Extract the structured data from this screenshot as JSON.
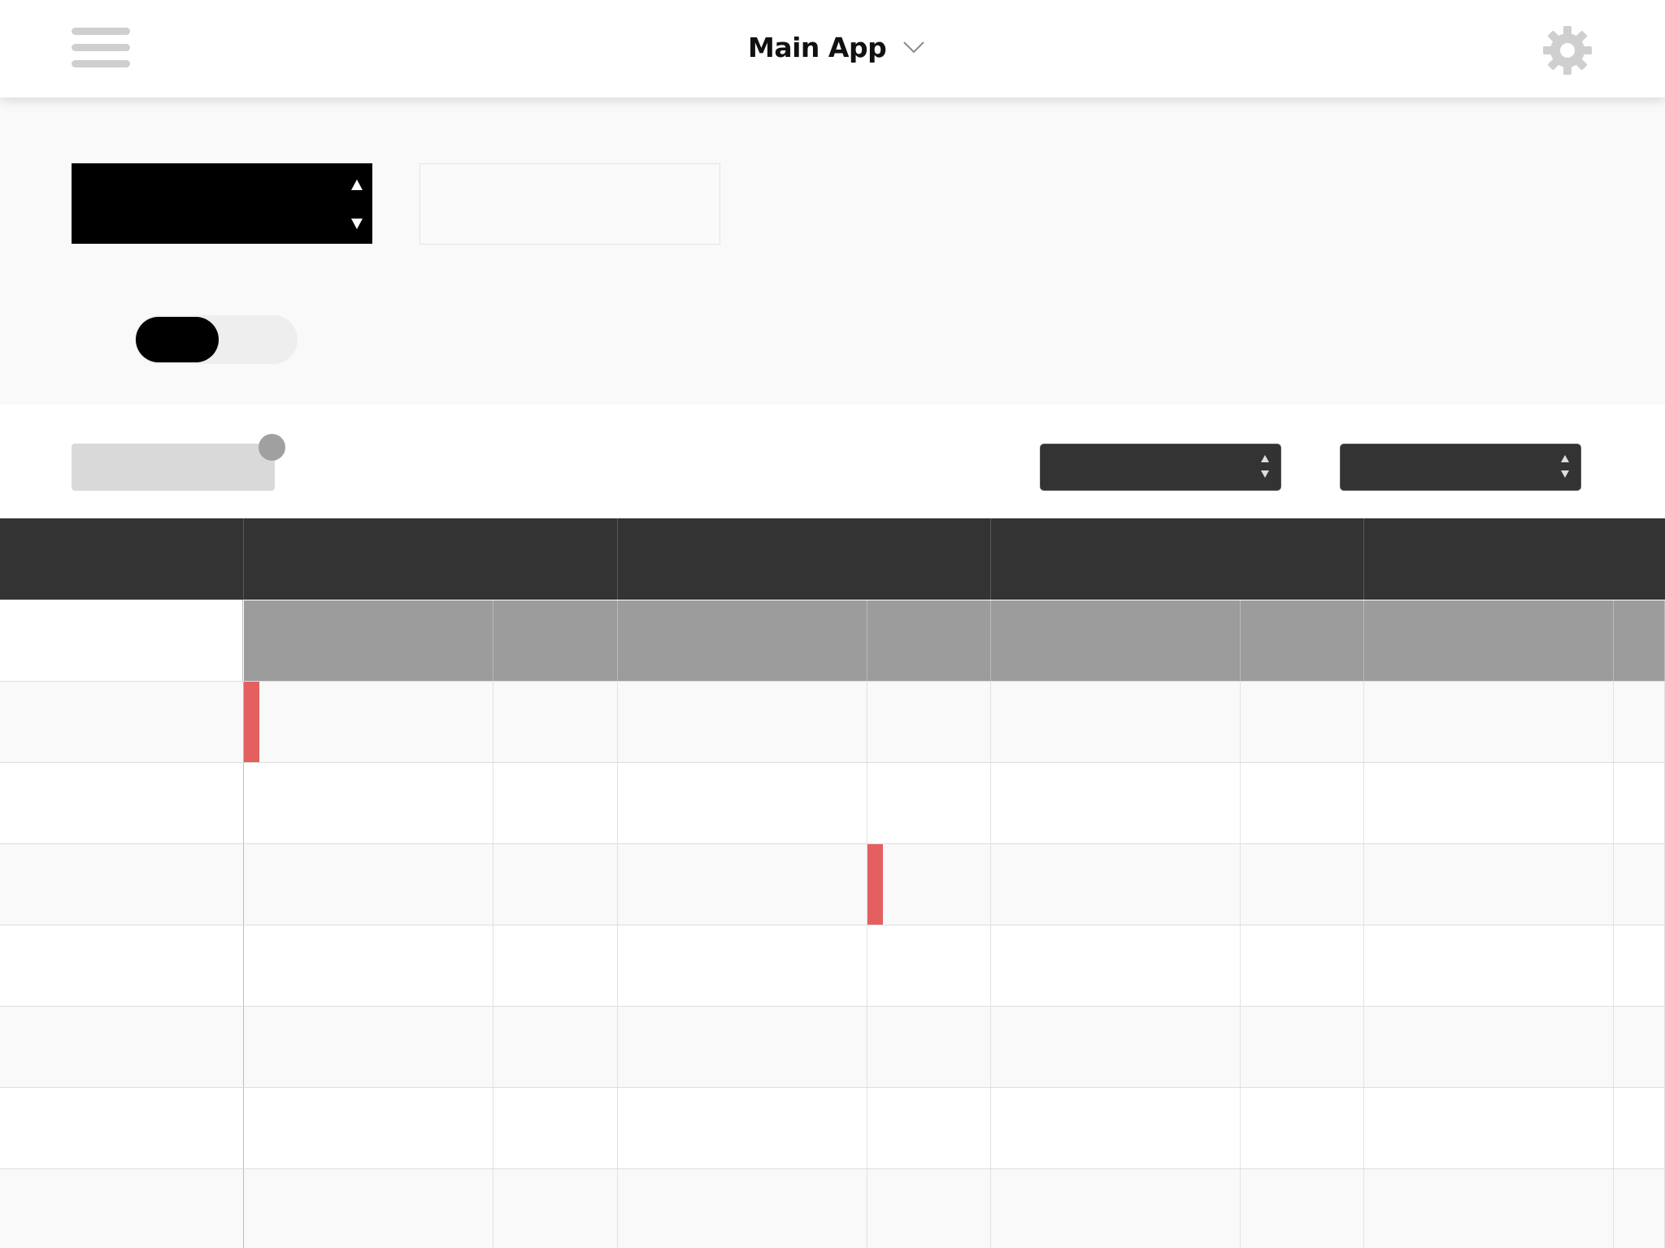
{
  "header": {
    "title": "Main App",
    "menu_icon": "hamburger-menu-icon",
    "dropdown_icon": "chevron-down-icon",
    "settings_icon": "gear-icon"
  },
  "form": {
    "stepper_value": "",
    "text_value": "",
    "toggle_on": false
  },
  "toolbar": {
    "slider_value": 1.0,
    "select_1_value": "",
    "select_2_value": ""
  },
  "grid": {
    "header_labels": [
      "",
      "",
      "",
      "",
      ""
    ],
    "subheader_labels": [
      "",
      "",
      "",
      "",
      "",
      "",
      "",
      ""
    ],
    "row_count": 7,
    "events": [
      {
        "row": 0,
        "column": 0
      },
      {
        "row": 2,
        "column": 3
      }
    ]
  },
  "colors": {
    "event": "#e45f5f",
    "header": "#333333",
    "subheader": "#9c9c9c",
    "accent": "#000000"
  }
}
